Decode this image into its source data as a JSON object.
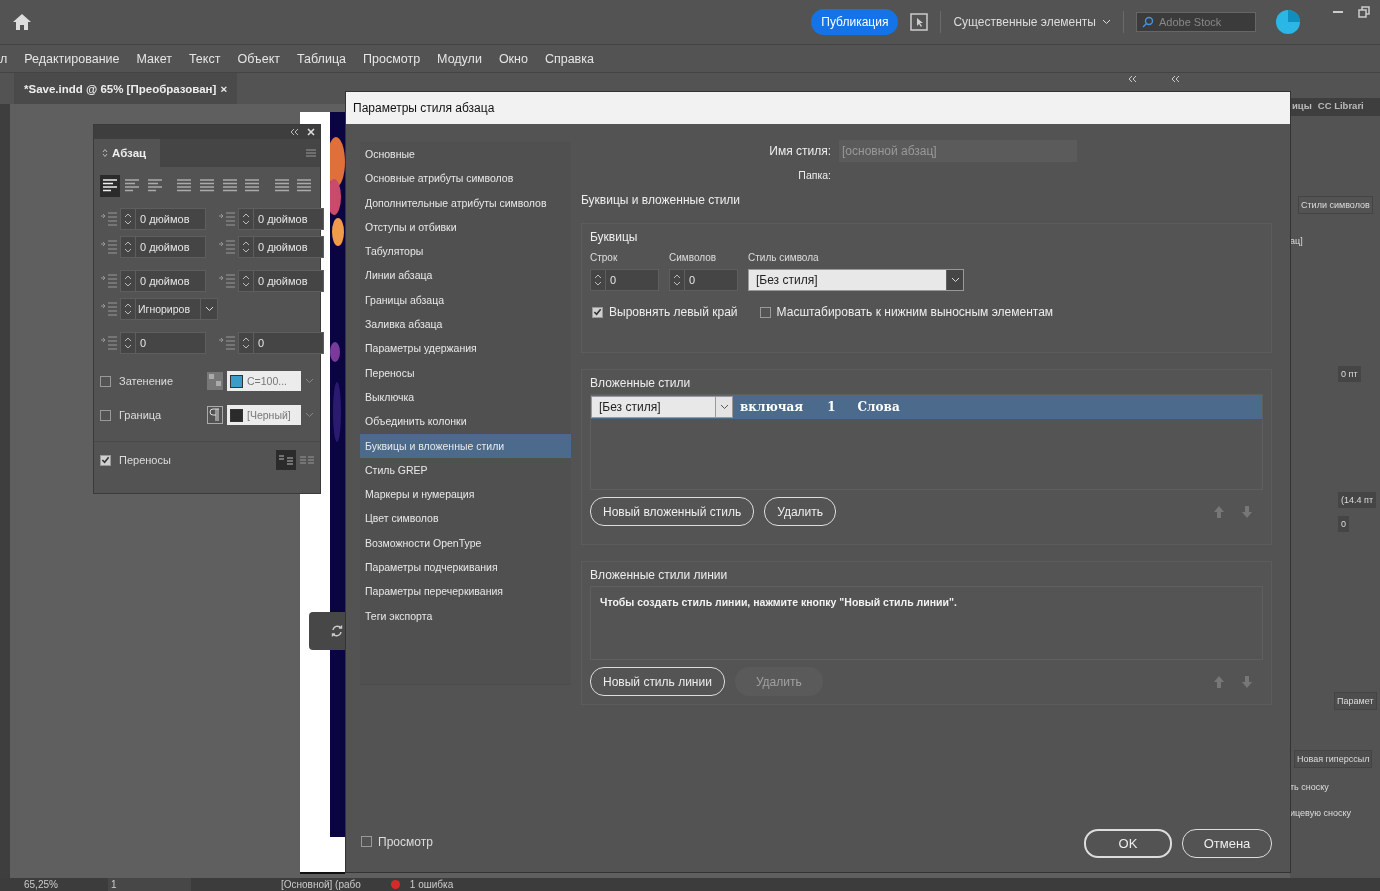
{
  "app_bar": {
    "publish_button": "Публикация",
    "workspace": "Существенные элементы",
    "search": {
      "placeholder": "Adobe Stock"
    }
  },
  "menu": [
    "л",
    "Редактирование",
    "Макет",
    "Текст",
    "Объект",
    "Таблица",
    "Просмотр",
    "Модули",
    "Окно",
    "Справка"
  ],
  "document_tab": {
    "title": "*Save.indd @ 65% [Преобразован]",
    "close": "×"
  },
  "paragraph_panel": {
    "title": "Абзац",
    "alignments": [
      {
        "selected": true
      },
      {
        "selected": false
      },
      {
        "selected": false
      },
      {
        "selected": false
      },
      {
        "selected": false
      },
      {
        "selected": false
      },
      {
        "selected": false
      },
      {
        "selected": false
      },
      {
        "selected": false
      }
    ],
    "field_rows": [
      [
        {
          "kind": "spin",
          "value": "0 дюймов"
        },
        {
          "kind": "spin",
          "value": "0 дюймов"
        }
      ],
      [
        {
          "kind": "spin",
          "value": "0 дюймов"
        },
        {
          "kind": "spin",
          "value": "0 дюймов"
        }
      ],
      [
        {
          "kind": "spin",
          "value": "0 дюймов"
        },
        {
          "kind": "spin",
          "value": "0 дюймов"
        }
      ],
      [
        {
          "kind": "dropdown",
          "value": "Игнориров"
        }
      ],
      [
        {
          "kind": "spin",
          "value": "0"
        },
        {
          "kind": "spin",
          "value": "0"
        }
      ]
    ],
    "shading": {
      "label": "Затенение",
      "checked": false,
      "swatch": "C=100...",
      "color": "#3a9cc8"
    },
    "border": {
      "label": "Граница",
      "checked": false,
      "swatch": "[Черный]",
      "color": "#2b2b2b"
    },
    "hyphenate": {
      "label": "Переносы",
      "checked": true
    }
  },
  "dialog": {
    "title": "Параметры стиля абзаца",
    "categories": [
      {
        "label": "Основные",
        "selected": false
      },
      {
        "label": "Основные атрибуты символов",
        "selected": false
      },
      {
        "label": "Дополнительные атрибуты символов",
        "selected": false
      },
      {
        "label": "Отступы и отбивки",
        "selected": false
      },
      {
        "label": "Табуляторы",
        "selected": false
      },
      {
        "label": "Линии абзаца",
        "selected": false
      },
      {
        "label": "Границы абзаца",
        "selected": false
      },
      {
        "label": "Заливка абзаца",
        "selected": false
      },
      {
        "label": "Параметры удержания",
        "selected": false
      },
      {
        "label": "Переносы",
        "selected": false
      },
      {
        "label": "Выключка",
        "selected": false
      },
      {
        "label": "Объединить колонки",
        "selected": false
      },
      {
        "label": "Буквицы и вложенные стили",
        "selected": true
      },
      {
        "label": "Стиль GREP",
        "selected": false
      },
      {
        "label": "Маркеры и нумерация",
        "selected": false
      },
      {
        "label": "Цвет символов",
        "selected": false
      },
      {
        "label": "Возможности OpenType",
        "selected": false
      },
      {
        "label": "Параметры подчеркивания",
        "selected": false
      },
      {
        "label": "Параметры перечеркивания",
        "selected": false
      },
      {
        "label": "Теги экспорта",
        "selected": false
      }
    ],
    "style_name_label": "Имя стиля:",
    "style_name": "[основной абзац]",
    "folder_label": "Папка:",
    "section_title": "Буквицы и вложенные стили",
    "drop_caps": {
      "title": "Буквицы",
      "lines_label": "Строк",
      "lines": "0",
      "chars_label": "Символов",
      "chars": "0",
      "char_style_label": "Стиль символа",
      "char_style": "[Без стиля]",
      "align_left": {
        "label": "Выровнять левый край",
        "checked": true
      },
      "scale": {
        "label": "Масштабировать к нижним выносным элементам",
        "checked": false
      }
    },
    "nested_styles": {
      "title": "Вложенные стили",
      "rows": [
        {
          "style": "[Без стиля]",
          "through": "включая",
          "count": "1",
          "unit": "Слова",
          "selected": true
        }
      ],
      "new_button": "Новый вложенный стиль",
      "delete_button": {
        "label": "Удалить",
        "disabled": false
      }
    },
    "line_styles": {
      "title": "Вложенные стили линии",
      "hint": "Чтобы создать стиль линии, нажмите кнопку \"Новый стиль линии\".",
      "new_button": "Новый стиль линии",
      "delete_button": {
        "label": "Удалить",
        "disabled": true
      }
    },
    "preview": {
      "label": "Просмотр",
      "checked": false
    },
    "ok_button": "OK",
    "cancel_button": "Отмена"
  },
  "right_dock": {
    "tabs": [
      "ицы",
      "CC Librari"
    ],
    "char_styles_tab": "Стили символов",
    "style_value": "ац]",
    "offset_field": "0 пт",
    "leading_field": "(14.4 пт",
    "tracking_field": "0",
    "params_button": "Парамет",
    "hyperlink_button": "Новая гиперссыл",
    "footnote_item": "ть сноску",
    "endnote_item": "ицевую сноску"
  },
  "status_bar": {
    "zoom": "65,25%",
    "page": "1",
    "master": "[Основной] (рабо",
    "errors": "1 ошибка"
  }
}
